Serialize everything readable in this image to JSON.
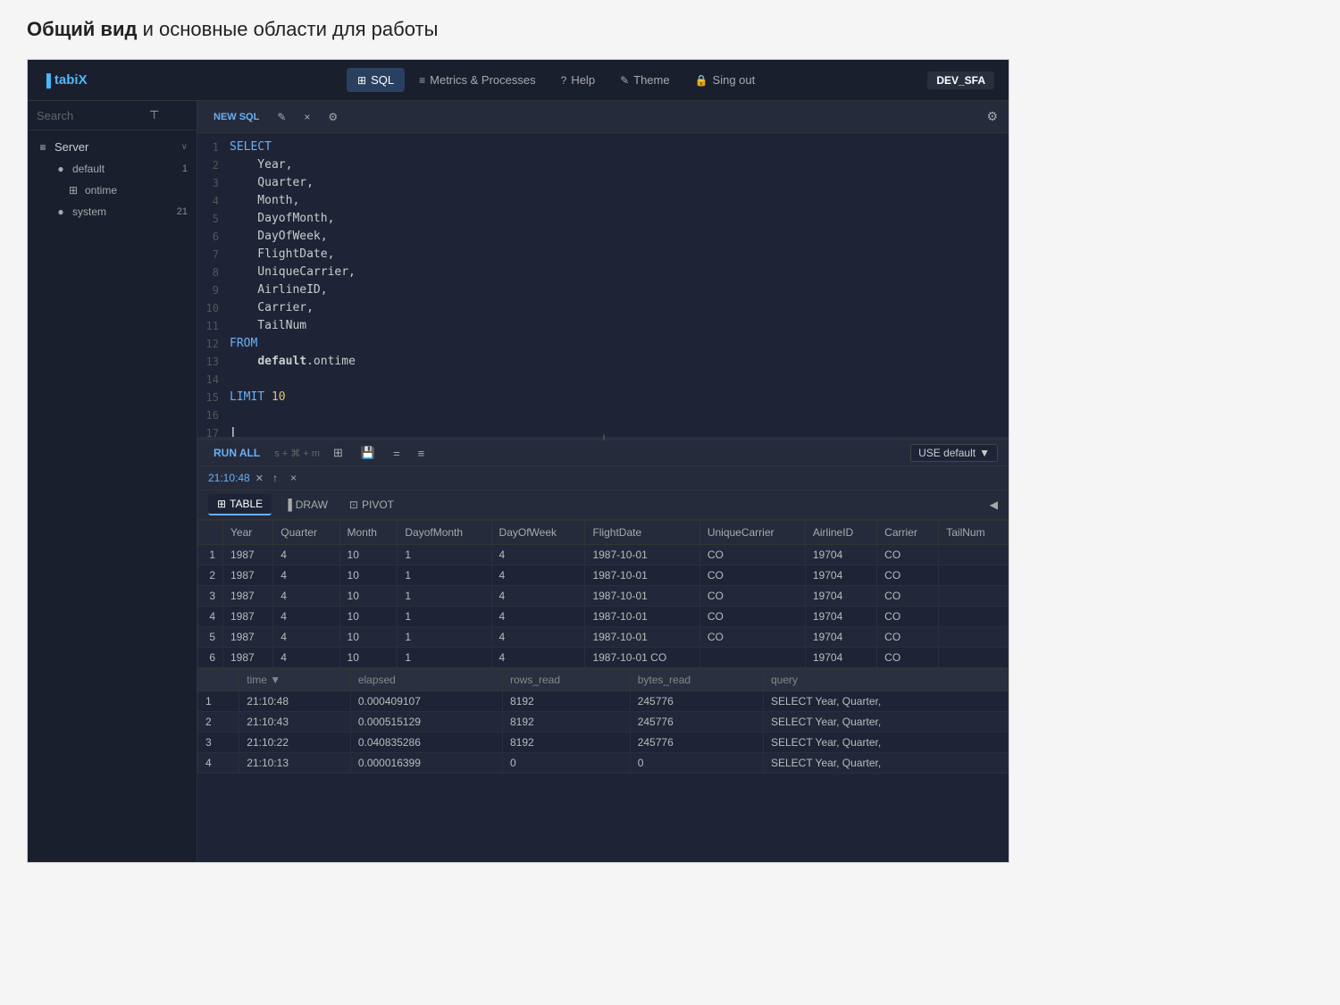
{
  "page": {
    "title_prefix": "Общий вид",
    "title_conjunction": " и ",
    "title_suffix": "основные области для работы"
  },
  "topnav": {
    "logo": "tabiX",
    "logo_icon": "▐",
    "nav_items": [
      {
        "id": "sql",
        "icon": "⊞",
        "label": "SQL",
        "active": true
      },
      {
        "id": "metrics",
        "icon": "≡",
        "label": "Metrics & Processes",
        "active": false
      },
      {
        "id": "help",
        "icon": "?",
        "label": "Help",
        "active": false
      },
      {
        "id": "theme",
        "icon": "✎",
        "label": "Theme",
        "active": false
      },
      {
        "id": "signout",
        "icon": "🔒",
        "label": "Sing out",
        "active": false
      }
    ],
    "env": "DEV_SFA"
  },
  "sidebar": {
    "search_placeholder": "Search",
    "groups": [
      {
        "label": "Server",
        "icon": "≡",
        "expanded": true,
        "items": [
          {
            "label": "default",
            "icon": "●",
            "badge": "1",
            "children": [
              {
                "label": "ontime",
                "icon": "⊞"
              }
            ]
          },
          {
            "label": "system",
            "icon": "●",
            "badge": "21"
          }
        ]
      }
    ]
  },
  "editor": {
    "toolbar": {
      "new_sql": "NEW SQL",
      "edit_icon": "✎",
      "close_icon": "×",
      "settings_icon": "⚙",
      "gear_icon": "⚙"
    },
    "lines": [
      {
        "num": 1,
        "content": "SELECT",
        "type": "keyword"
      },
      {
        "num": 2,
        "content": "    Year,",
        "type": "normal"
      },
      {
        "num": 3,
        "content": "    Quarter,",
        "type": "normal"
      },
      {
        "num": 4,
        "content": "    Month,",
        "type": "normal"
      },
      {
        "num": 5,
        "content": "    DayofMonth,",
        "type": "normal"
      },
      {
        "num": 6,
        "content": "    DayOfWeek,",
        "type": "normal"
      },
      {
        "num": 7,
        "content": "    FlightDate,",
        "type": "normal"
      },
      {
        "num": 8,
        "content": "    UniqueCarrier,",
        "type": "normal"
      },
      {
        "num": 9,
        "content": "    AirlineID,",
        "type": "normal"
      },
      {
        "num": 10,
        "content": "    Carrier,",
        "type": "normal"
      },
      {
        "num": 11,
        "content": "    TailNum",
        "type": "normal"
      },
      {
        "num": 12,
        "content": "FROM",
        "type": "keyword"
      },
      {
        "num": 13,
        "content": "    default.ontime",
        "type": "table"
      },
      {
        "num": 14,
        "content": "",
        "type": "normal"
      },
      {
        "num": 15,
        "content": "LIMIT 10",
        "type": "keyword_limit"
      },
      {
        "num": 16,
        "content": "",
        "type": "normal"
      },
      {
        "num": 17,
        "content": "",
        "type": "cursor"
      }
    ]
  },
  "run_toolbar": {
    "run_all": "RUN ALL",
    "shortcuts": "s + ⌘ + m",
    "resize_icon": "⊞",
    "save_icon": "💾",
    "menu_icon": "≡",
    "db_label": "USE default",
    "db_arrow": "▼",
    "eq_icon": "="
  },
  "result_tabs": {
    "timestamp": "21:10:48",
    "cancel_icon": "✕",
    "icons": [
      "↑",
      "×"
    ]
  },
  "view_tabs": {
    "tabs": [
      {
        "id": "table",
        "label": "TABLE",
        "icon": "⊞",
        "active": true
      },
      {
        "id": "draw",
        "label": "DRAW",
        "icon": "▐"
      },
      {
        "id": "pivot",
        "label": "PIVOT",
        "icon": "⊡"
      }
    ],
    "collapse_icon": "◀"
  },
  "data_table": {
    "columns": [
      "",
      "Year",
      "Quarter",
      "Month",
      "DayofMonth",
      "DayOfWeek",
      "FlightDate",
      "UniqueCarrier",
      "AirlineID",
      "Carrier",
      "TailNum"
    ],
    "rows": [
      [
        1,
        1987,
        4,
        10,
        1,
        4,
        "1987-10-01",
        "CO",
        19704,
        "CO",
        ""
      ],
      [
        2,
        1987,
        4,
        10,
        1,
        4,
        "1987-10-01",
        "CO",
        19704,
        "CO",
        ""
      ],
      [
        3,
        1987,
        4,
        10,
        1,
        4,
        "1987-10-01",
        "CO",
        19704,
        "CO",
        ""
      ],
      [
        4,
        1987,
        4,
        10,
        1,
        4,
        "1987-10-01",
        "CO",
        19704,
        "CO",
        ""
      ],
      [
        5,
        1987,
        4,
        10,
        1,
        4,
        "1987-10-01",
        "CO",
        19704,
        "CO",
        ""
      ],
      [
        6,
        1987,
        4,
        10,
        1,
        4,
        "1987-10-01 CO",
        "",
        19704,
        "CO",
        ""
      ]
    ]
  },
  "query_log": {
    "columns": [
      "",
      "time ▼",
      "elapsed",
      "rows_read",
      "bytes_read",
      "query"
    ],
    "rows": [
      [
        1,
        "21:10:48",
        "0.000409107",
        "8192",
        "245776",
        "SELECT Year, Quarter,"
      ],
      [
        2,
        "21:10:43",
        "0.000515129",
        "8192",
        "245776",
        "SELECT Year, Quarter,"
      ],
      [
        3,
        "21:10:22",
        "0.040835286",
        "8192",
        "245776",
        "SELECT Year, Quarter,"
      ],
      [
        4,
        "21:10:13",
        "0.000016399",
        "0",
        "0",
        "SELECT Year, Quarter,"
      ]
    ]
  }
}
